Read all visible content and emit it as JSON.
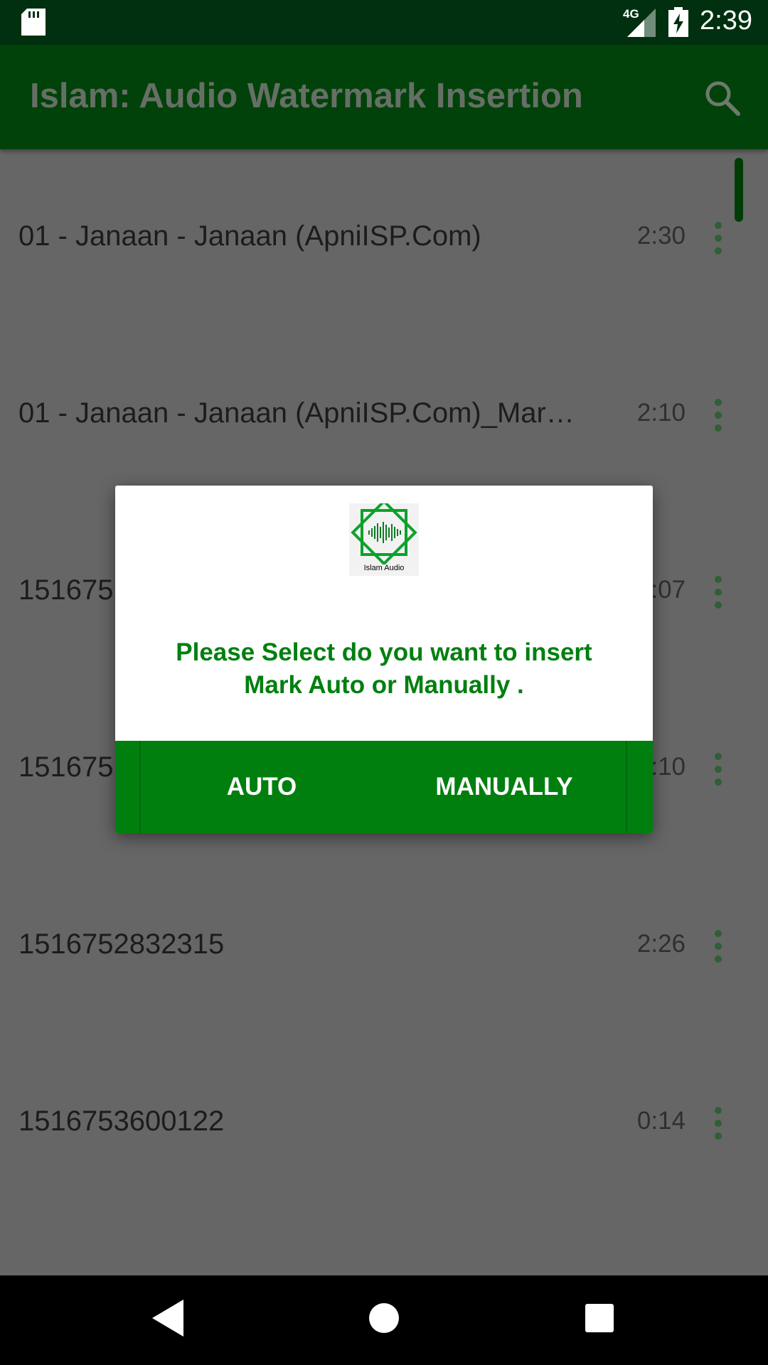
{
  "status_bar": {
    "time": "2:39",
    "network": "4G"
  },
  "app_bar": {
    "title": "Islam: Audio Watermark Insertion"
  },
  "list": {
    "items": [
      {
        "title": "01 - Janaan - Janaan (ApniISP.Com)",
        "duration": "2:30"
      },
      {
        "title": "01 - Janaan - Janaan (ApniISP.Com)_Mar…",
        "duration": "2:10"
      },
      {
        "title": "151675",
        "duration": ":07"
      },
      {
        "title": "151675",
        "duration": ":10"
      },
      {
        "title": "1516752832315",
        "duration": "2:26"
      },
      {
        "title": "1516753600122",
        "duration": "0:14"
      }
    ]
  },
  "dialog": {
    "logo_text": "Islam Audio",
    "message": "Please Select do you want to insert Mark Auto or Manually .",
    "auto_label": "AUTO",
    "manual_label": "MANUALLY"
  },
  "colors": {
    "status_bar": "#00300f",
    "app_bar": "#004209",
    "accent_green": "#007f0f",
    "scrim": "#666666"
  }
}
